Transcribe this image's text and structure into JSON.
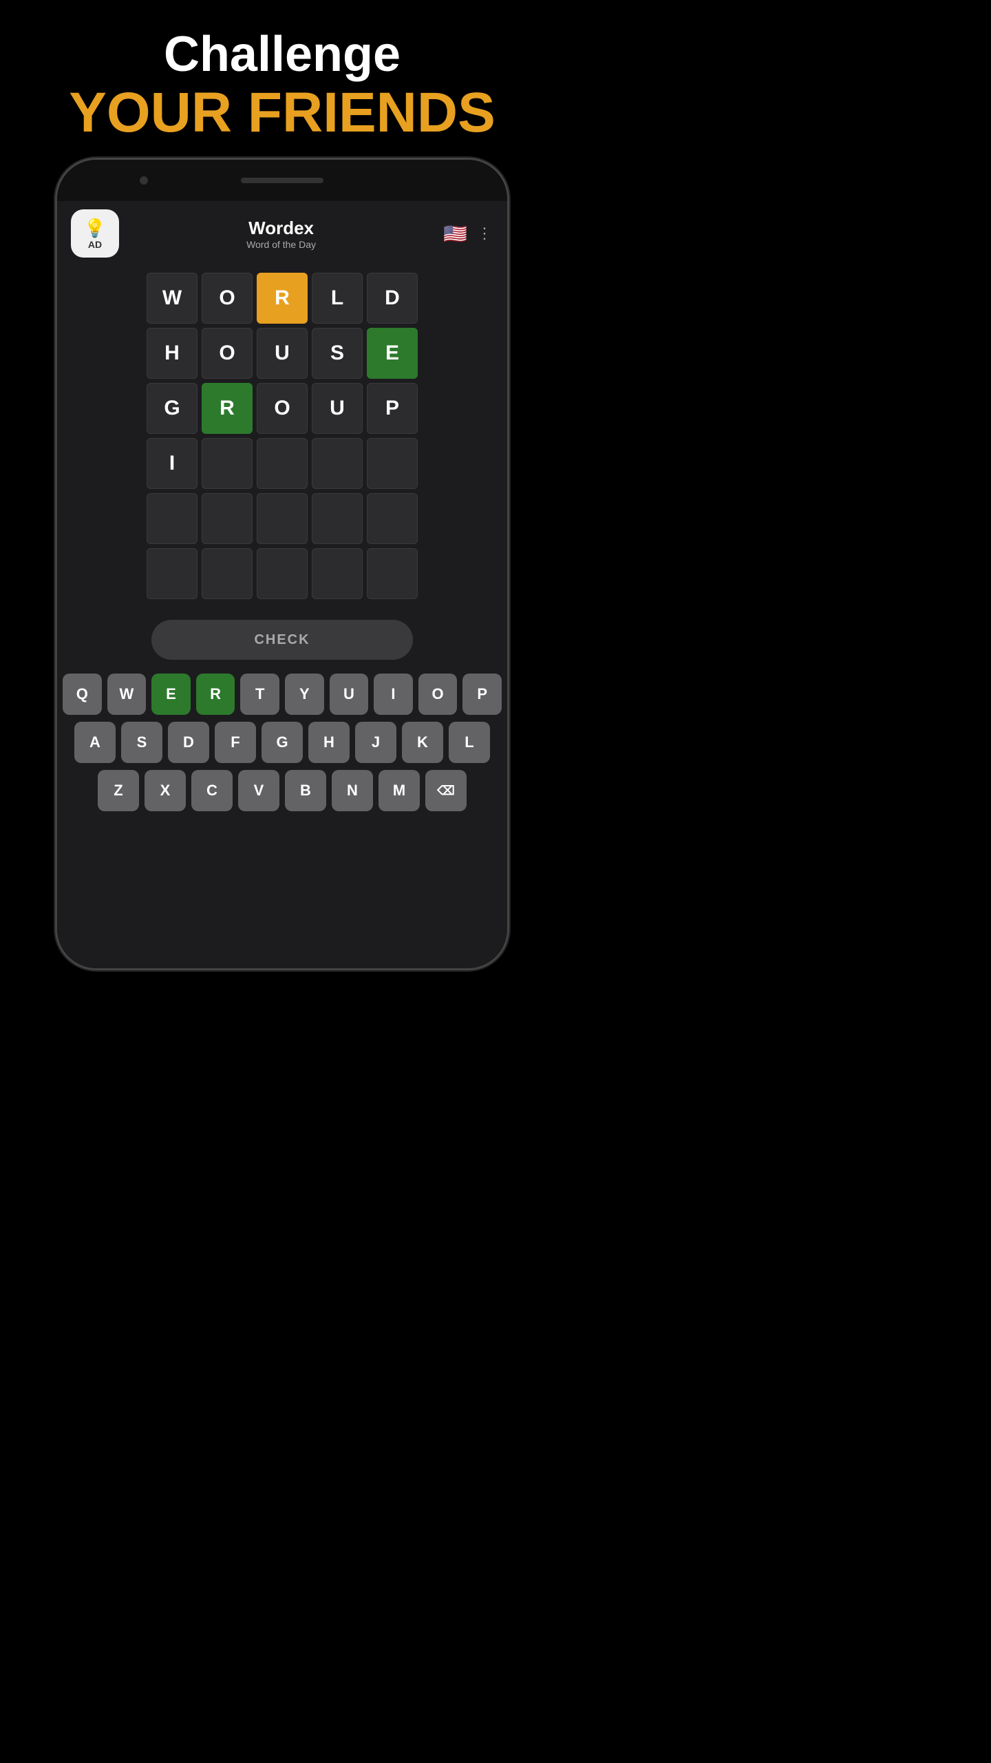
{
  "header": {
    "line1": "Challenge",
    "line2": "YOUR FRIENDS"
  },
  "app": {
    "title": "Wordex",
    "subtitle": "Word of the Day"
  },
  "ad": {
    "icon": "💡",
    "label": "AD"
  },
  "grid": {
    "rows": [
      [
        {
          "letter": "W",
          "state": "normal"
        },
        {
          "letter": "O",
          "state": "normal"
        },
        {
          "letter": "R",
          "state": "orange"
        },
        {
          "letter": "L",
          "state": "normal"
        },
        {
          "letter": "D",
          "state": "normal"
        }
      ],
      [
        {
          "letter": "H",
          "state": "normal"
        },
        {
          "letter": "O",
          "state": "normal"
        },
        {
          "letter": "U",
          "state": "normal"
        },
        {
          "letter": "S",
          "state": "normal"
        },
        {
          "letter": "E",
          "state": "green"
        }
      ],
      [
        {
          "letter": "G",
          "state": "normal"
        },
        {
          "letter": "R",
          "state": "green"
        },
        {
          "letter": "O",
          "state": "normal"
        },
        {
          "letter": "U",
          "state": "normal"
        },
        {
          "letter": "P",
          "state": "normal"
        }
      ],
      [
        {
          "letter": "I",
          "state": "normal"
        },
        {
          "letter": "",
          "state": "empty"
        },
        {
          "letter": "",
          "state": "empty"
        },
        {
          "letter": "",
          "state": "empty"
        },
        {
          "letter": "",
          "state": "empty"
        }
      ],
      [
        {
          "letter": "",
          "state": "empty"
        },
        {
          "letter": "",
          "state": "empty"
        },
        {
          "letter": "",
          "state": "empty"
        },
        {
          "letter": "",
          "state": "empty"
        },
        {
          "letter": "",
          "state": "empty"
        }
      ],
      [
        {
          "letter": "",
          "state": "empty"
        },
        {
          "letter": "",
          "state": "empty"
        },
        {
          "letter": "",
          "state": "empty"
        },
        {
          "letter": "",
          "state": "empty"
        },
        {
          "letter": "",
          "state": "empty"
        }
      ]
    ]
  },
  "check_button": {
    "label": "CHECK"
  },
  "keyboard": {
    "rows": [
      [
        {
          "key": "Q",
          "state": "normal"
        },
        {
          "key": "W",
          "state": "normal"
        },
        {
          "key": "E",
          "state": "green"
        },
        {
          "key": "R",
          "state": "green"
        },
        {
          "key": "T",
          "state": "normal"
        },
        {
          "key": "Y",
          "state": "normal"
        },
        {
          "key": "U",
          "state": "normal"
        },
        {
          "key": "I",
          "state": "normal"
        },
        {
          "key": "O",
          "state": "normal"
        },
        {
          "key": "P",
          "state": "normal"
        }
      ],
      [
        {
          "key": "A",
          "state": "normal"
        },
        {
          "key": "S",
          "state": "normal"
        },
        {
          "key": "D",
          "state": "normal"
        },
        {
          "key": "F",
          "state": "normal"
        },
        {
          "key": "G",
          "state": "normal"
        },
        {
          "key": "H",
          "state": "normal"
        },
        {
          "key": "J",
          "state": "normal"
        },
        {
          "key": "K",
          "state": "normal"
        },
        {
          "key": "L",
          "state": "normal"
        }
      ],
      [
        {
          "key": "Z",
          "state": "normal"
        },
        {
          "key": "X",
          "state": "normal"
        },
        {
          "key": "C",
          "state": "normal"
        },
        {
          "key": "V",
          "state": "normal"
        },
        {
          "key": "B",
          "state": "normal"
        },
        {
          "key": "N",
          "state": "normal"
        },
        {
          "key": "M",
          "state": "normal"
        },
        {
          "key": "⌫",
          "state": "backspace"
        }
      ]
    ]
  }
}
